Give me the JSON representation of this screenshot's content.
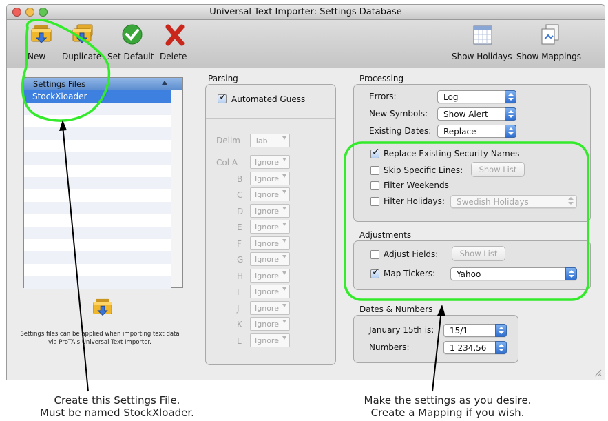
{
  "window": {
    "title": "Universal Text Importer:  Settings Database"
  },
  "toolbar": {
    "new_label": "New",
    "duplicate_label": "Duplicate",
    "set_default_label": "Set Default",
    "delete_label": "Delete",
    "show_holidays_label": "Show Holidays",
    "show_mappings_label": "Show Mappings"
  },
  "settings_list": {
    "header": "Settings Files",
    "items": [
      "StockXloader"
    ]
  },
  "settings_note": "Settings files can be applied when importing text data via ProTA's Universal Text Importer.",
  "parsing": {
    "title": "Parsing",
    "automated_guess": "Automated Guess",
    "delim_label": "Delim",
    "delim_value": "Tab",
    "columns": [
      {
        "label": "Col A",
        "value": "Ignore"
      },
      {
        "label": "B",
        "value": "Ignore"
      },
      {
        "label": "C",
        "value": "Ignore"
      },
      {
        "label": "D",
        "value": "Ignore"
      },
      {
        "label": "E",
        "value": "Ignore"
      },
      {
        "label": "F",
        "value": "Ignore"
      },
      {
        "label": "G",
        "value": "Ignore"
      },
      {
        "label": "H",
        "value": "Ignore"
      },
      {
        "label": "I",
        "value": "Ignore"
      },
      {
        "label": "J",
        "value": "Ignore"
      },
      {
        "label": "K",
        "value": "Ignore"
      },
      {
        "label": "L",
        "value": "Ignore"
      }
    ]
  },
  "processing": {
    "title": "Processing",
    "errors_label": "Errors:",
    "errors_value": "Log",
    "new_symbols_label": "New Symbols:",
    "new_symbols_value": "Show Alert",
    "existing_dates_label": "Existing Dates:",
    "existing_dates_value": "Replace",
    "replace_names": "Replace Existing Security Names",
    "skip_lines": "Skip Specific Lines:",
    "show_list": "Show List",
    "filter_weekends": "Filter Weekends",
    "filter_holidays": "Filter Holidays:",
    "holidays_value": "Swedish Holidays"
  },
  "adjustments": {
    "title": "Adjustments",
    "adjust_fields": "Adjust Fields:",
    "show_list": "Show List",
    "map_tickers": "Map Tickers:",
    "map_tickers_value": "Yahoo"
  },
  "dates_numbers": {
    "title": "Dates & Numbers",
    "jan15_label": "January 15th is:",
    "jan15_value": "15/1",
    "numbers_label": "Numbers:",
    "numbers_value": "1 234,56"
  },
  "annotations": {
    "left_line1": "Create this Settings File.",
    "left_line2": "Must be named StockXloader.",
    "right_line1": "Make the settings as you desire.",
    "right_line2": "Create a Mapping if you wish."
  },
  "colors": {
    "highlight": "#33ea2b",
    "selection": "#3d80df"
  }
}
